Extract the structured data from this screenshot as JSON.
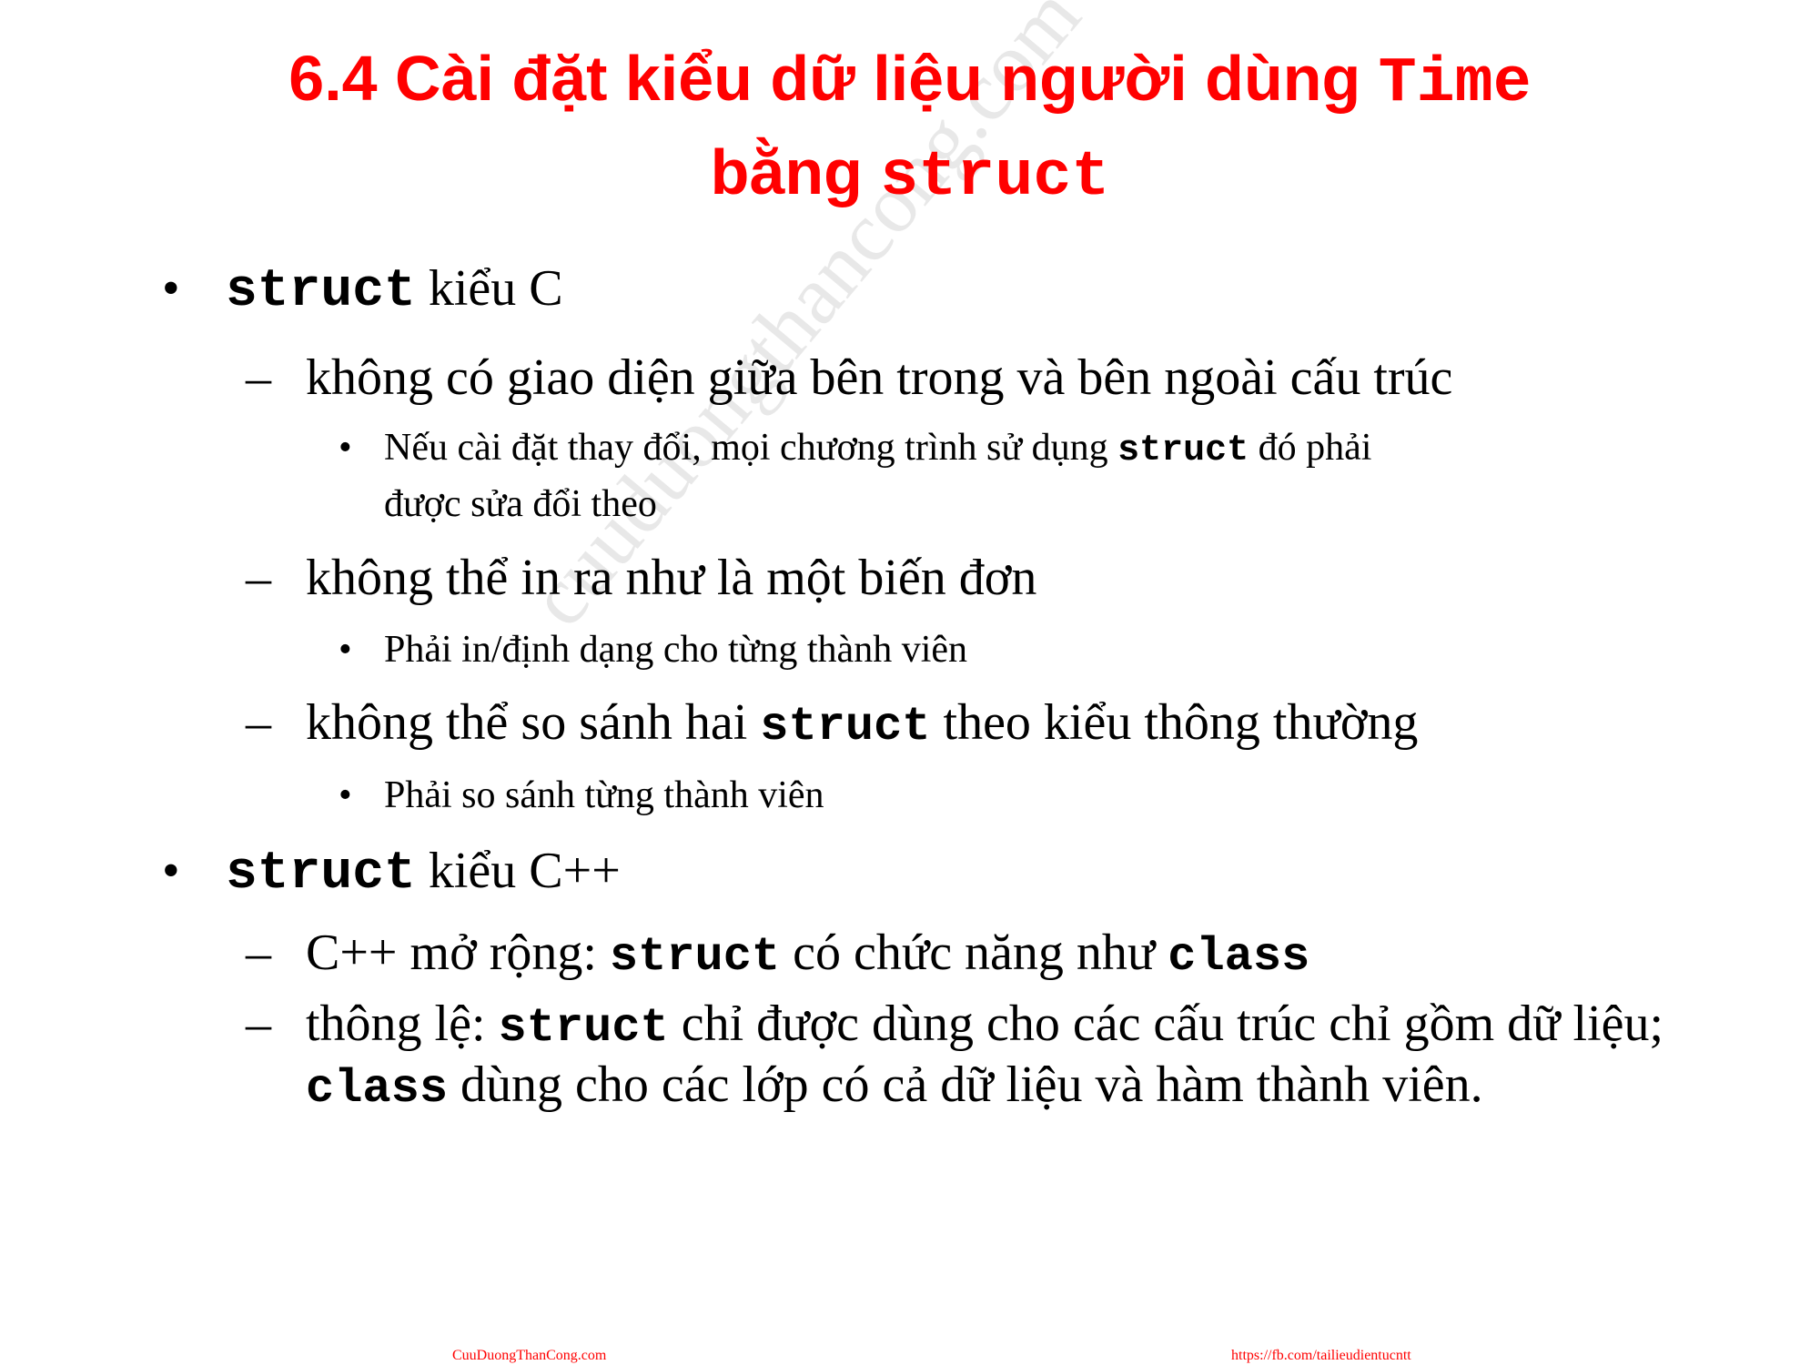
{
  "slide": {
    "title_line1_prefix": "6.4 Cài đặt kiểu dữ liệu người dùng ",
    "title_line1_code": "Time",
    "title_line2_prefix": "bằng ",
    "title_line2_code": "struct",
    "bullet_marker": "•",
    "dash_marker": "–",
    "b1": {
      "code": "struct",
      "text": " kiểu C"
    },
    "b1_1": "không có giao diện giữa bên trong và bên ngoài cấu trúc",
    "b1_1_1": {
      "prefix": "Nếu cài đặt thay đổi, mọi chương trình sử dụng ",
      "code": "struct",
      "suffix": " đó phải",
      "line2": "được sửa đổi theo"
    },
    "b1_2": "không thể in ra như là một biến đơn",
    "b1_2_1": "Phải in/định dạng cho từng thành viên",
    "b1_3": {
      "prefix": "không thể so sánh hai ",
      "code": "struct",
      "suffix": " theo kiểu thông thường"
    },
    "b1_3_1": "Phải so sánh từng thành viên",
    "b2": {
      "code": "struct",
      "text": " kiểu C++"
    },
    "b2_1": {
      "prefix": "C++ mở rộng: ",
      "code1": "struct",
      "middle": " có chức năng như ",
      "code2": "class"
    },
    "b2_2": {
      "prefix": "thông lệ: ",
      "code1": "struct",
      "suffix": " chỉ được dùng cho các cấu trúc chỉ gồm dữ liệu;",
      "code2": "class",
      "line2": " dùng cho các lớp có cả dữ liệu và hàm thành viên."
    }
  },
  "watermark": "cuuduongthancong.com",
  "footer": {
    "left": "CuuDuongThanCong.com",
    "right": "https://fb.com/tailieudientucntt"
  }
}
